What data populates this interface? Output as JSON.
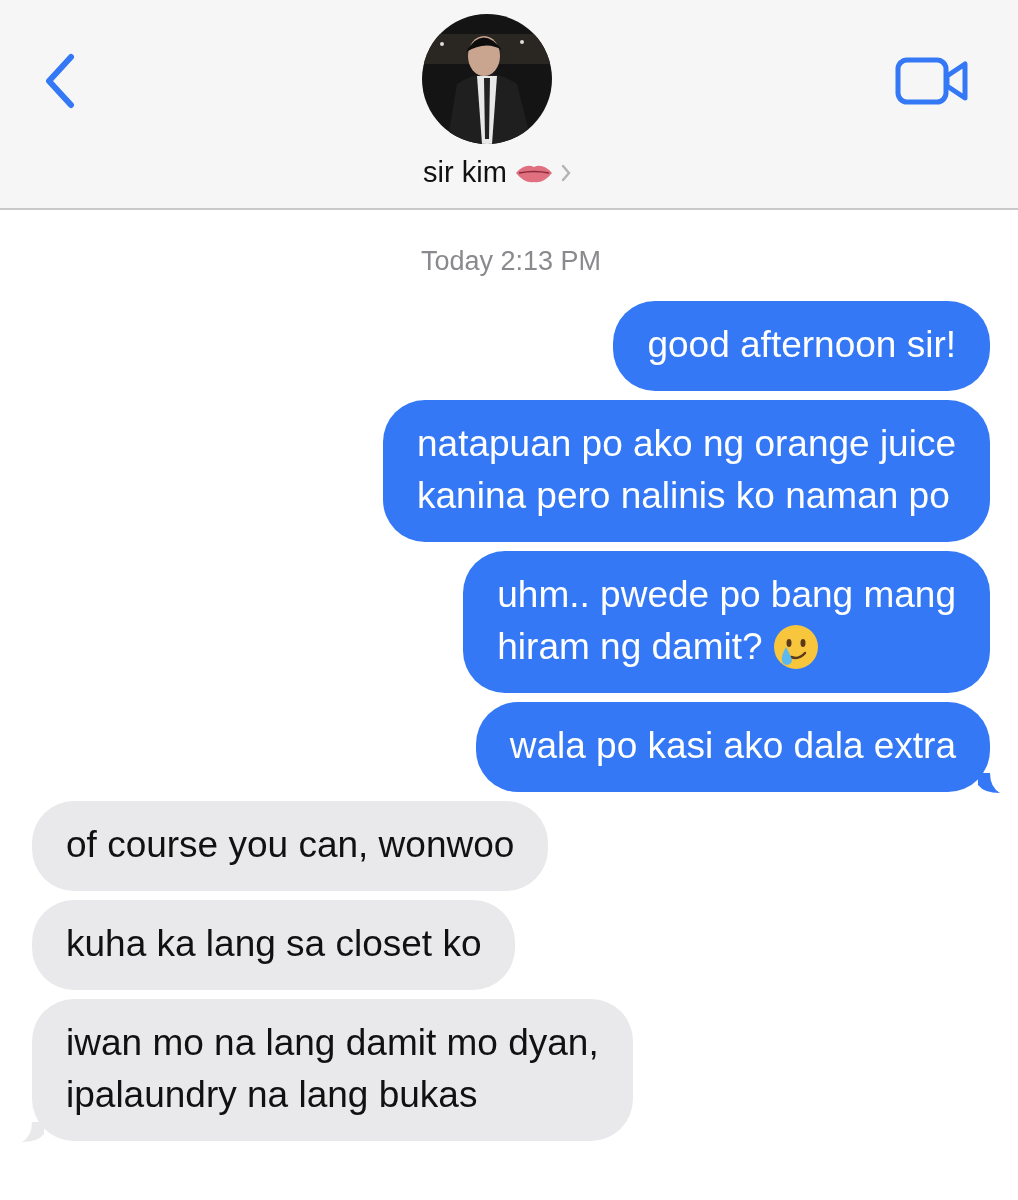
{
  "header": {
    "contact_name": "sir kim"
  },
  "timestamp": "Today 2:13 PM",
  "messages": [
    {
      "kind": "sent",
      "lines": [
        "good afternoon sir!"
      ],
      "tail": false,
      "trailing_icon": false
    },
    {
      "kind": "sent",
      "lines": [
        "natapuan po ako ng orange juice",
        "kanina pero nalinis ko naman po"
      ],
      "tail": false,
      "trailing_icon": false
    },
    {
      "kind": "sent",
      "lines": [
        "uhm.. pwede po bang mang",
        "hiram ng damit?"
      ],
      "tail": false,
      "trailing_icon": true
    },
    {
      "kind": "sent",
      "lines": [
        "wala po kasi ako dala extra"
      ],
      "tail": true,
      "trailing_icon": false
    },
    {
      "kind": "received",
      "lines": [
        "of course you can, wonwoo"
      ],
      "tail": false,
      "trailing_icon": false
    },
    {
      "kind": "received",
      "lines": [
        "kuha ka lang sa closet ko"
      ],
      "tail": false,
      "trailing_icon": false
    },
    {
      "kind": "received",
      "lines": [
        "iwan mo na lang damit mo dyan,",
        "ipalaundry na lang bukas"
      ],
      "tail": true,
      "trailing_icon": false
    }
  ]
}
